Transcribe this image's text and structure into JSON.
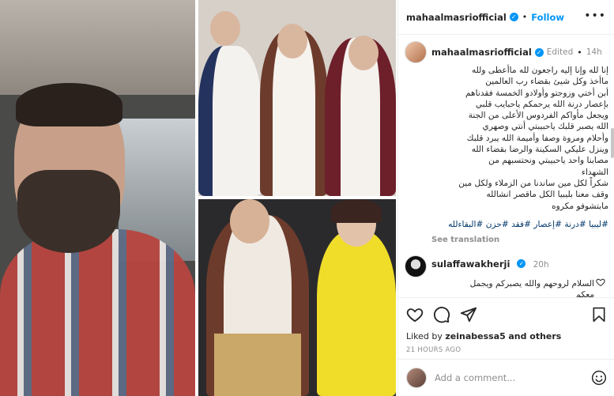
{
  "header": {
    "username": "mahaalmasriofficial",
    "follow_label": "Follow",
    "more_icon": "more-dots-icon"
  },
  "caption": {
    "username": "mahaalmasriofficial",
    "edited": "Edited",
    "time": "14h",
    "text": "إنا لله وإنا إليه راجعون لله ماأعطى ولله\nماأخذ وكل شيئ بقضاء رب العالمين\nأبن أختي وزوجتو وأولادو الخمسة فقدناهم\nبإعصار درنة الله يرحمكم ياحبايب قلبي\nويجعل مأواكم الفردوس الأعلى من الجنة\nالله يصبر قلبك ياحبيبتي أنتي وصهري\nوأحلام ومروة وصفا وأميمة الله يبرد قلبك\nوينزل عليكي السكينة والرضا بقضاء الله\nمصابنا واحد ياحبيبتي ونحتسبهم من\nالشهداء\nشكراً لكل مين ساندنا من الزملاء ولكل مين\nوقف معنا بليبيا الكل ماقصر انشالله\nمابتشوفو مكروه",
    "hashtags": "#ليبيا #درنة #إعصار #فقد #حزن #البقاءلله",
    "see_translation": "See translation"
  },
  "comment": {
    "username": "sulaffawakherji",
    "time": "20h",
    "text": "السلام لروحهم والله يصبركم ويجمل\nمعكم"
  },
  "actions": {
    "like_icon": "heart-icon",
    "comment_icon": "comment-icon",
    "share_icon": "share-icon",
    "save_icon": "bookmark-icon"
  },
  "likes": {
    "prefix": "Liked by",
    "user": "zeinabessa5",
    "suffix": "and others"
  },
  "timestamp": "21 HOURS AGO",
  "add_comment": {
    "placeholder": "Add a comment..."
  },
  "colors": {
    "link_blue": "#0095f6",
    "verified_blue": "#0095f6",
    "muted": "#8e8e8e",
    "hashtag": "#00376b"
  }
}
